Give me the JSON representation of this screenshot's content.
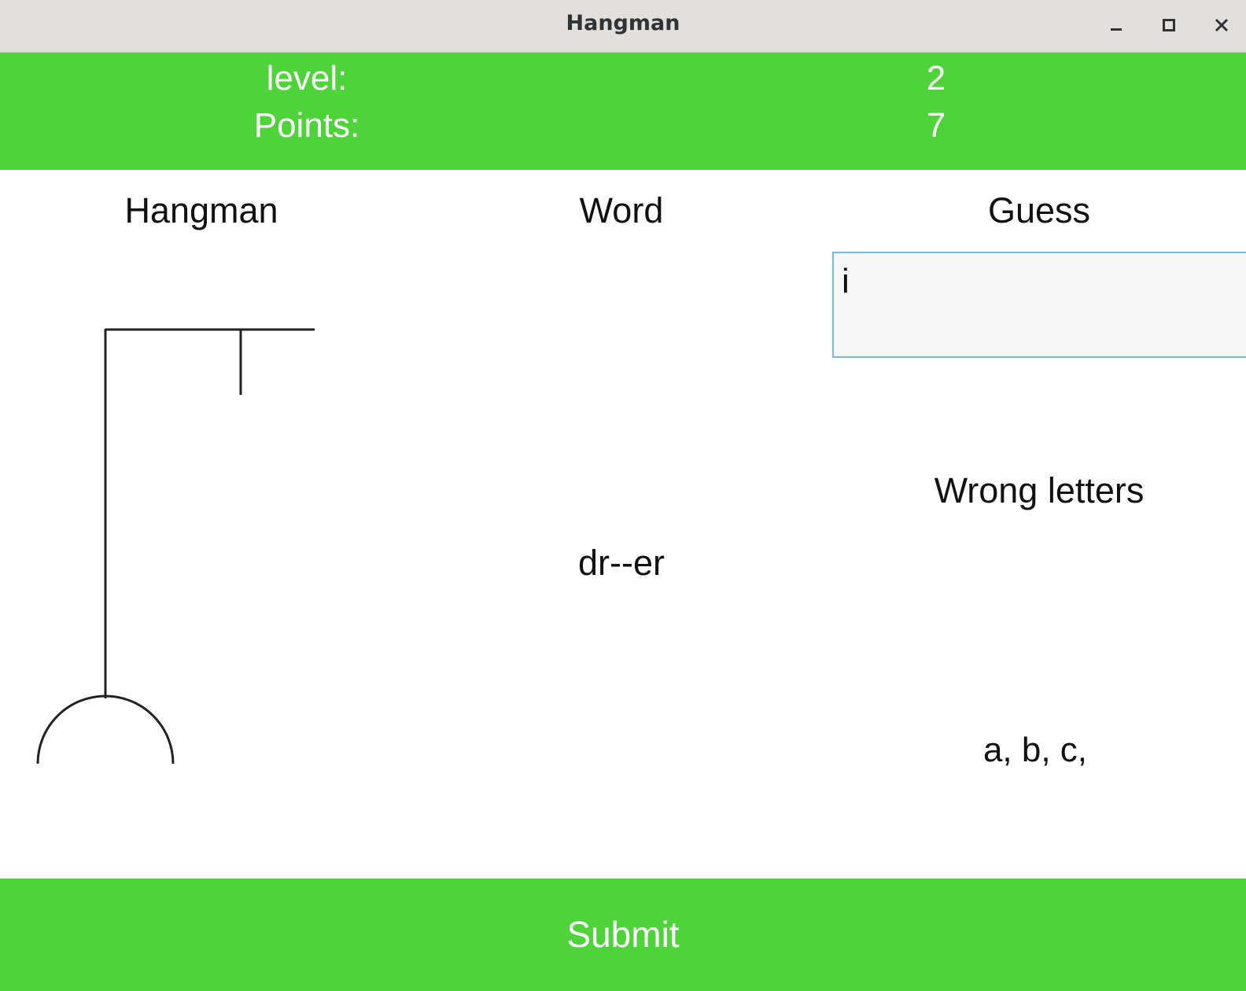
{
  "window": {
    "title": "Hangman",
    "controls": {
      "minimize": "minimize-icon",
      "maximize": "maximize-icon",
      "close": "close-icon"
    }
  },
  "header": {
    "level_label": "level:",
    "level_value": "2",
    "points_label": "Points:",
    "points_value": "7",
    "background_color": "#4fd33a",
    "text_color": "#ffffff"
  },
  "columns": {
    "hangman_heading": "Hangman",
    "word_heading": "Word",
    "guess_heading": "Guess"
  },
  "game": {
    "masked_word": "dr--er",
    "guess_input_value": "i",
    "wrong_letters_heading": "Wrong letters",
    "wrong_letters": "a, b, c,",
    "hangman_stage": "gallows-only"
  },
  "actions": {
    "submit_label": "Submit",
    "submit_color": "#4fd33a"
  }
}
